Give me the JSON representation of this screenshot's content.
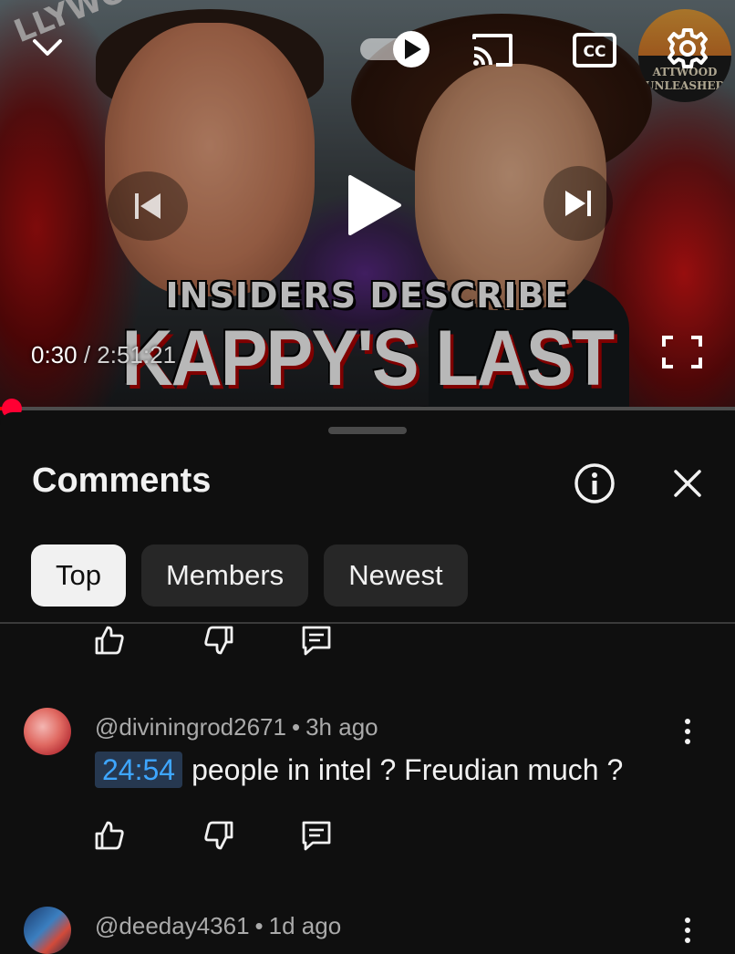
{
  "player": {
    "thumbnail": {
      "title_line1": "INSIDERS DESCRIBE",
      "title_line2": "KAPPY'S LAST DAYS!",
      "sign_text": "LLYWOO",
      "channel_logo_top": "ATTWOOD",
      "channel_logo_bottom": "UNLEASHED"
    },
    "current_time": "0:30",
    "separator": " / ",
    "duration": "2:51:21",
    "progress_percent": 0.3,
    "icons": {
      "collapse": "chevron-down-icon",
      "autoplay": "autoplay-toggle-icon",
      "cast": "cast-icon",
      "captions": "cc-icon",
      "settings": "gear-icon",
      "previous": "skip-previous-icon",
      "play": "play-icon",
      "next": "skip-next-icon",
      "fullscreen": "fullscreen-icon"
    },
    "accent_color": "#ff0000"
  },
  "comments_panel": {
    "title": "Comments",
    "filters": [
      {
        "label": "Top",
        "selected": true
      },
      {
        "label": "Members",
        "selected": false
      },
      {
        "label": "Newest",
        "selected": false
      }
    ],
    "comments": [
      {
        "author": "@diviningrod2671",
        "time": "3h ago",
        "timestamp_link": "24:54",
        "text": "people in intel ? Freudian much ?"
      },
      {
        "author": "@deeday4361",
        "time": "1d ago"
      }
    ],
    "meta_separator": "•",
    "link_color": "#3ea6ff"
  }
}
